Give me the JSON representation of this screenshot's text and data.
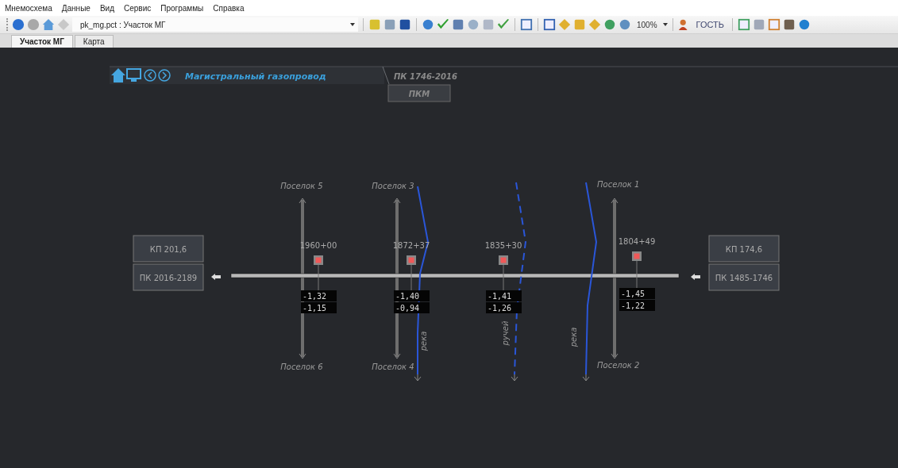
{
  "menu": [
    "Мнемосхема",
    "Данные",
    "Вид",
    "Сервис",
    "Программы",
    "Справка"
  ],
  "toolbar": {
    "file": "pk_mg.pct : Участок МГ",
    "zoom": "100%",
    "user": "ГОСТЬ"
  },
  "tabs": [
    {
      "label": "Участок МГ",
      "selected": true
    },
    {
      "label": "Карта",
      "selected": false
    }
  ],
  "scheme": {
    "breadcrumb": "Магистральный газопровод",
    "section": "ПК 1746-2016",
    "section_button": "ПКМ",
    "left_boxes": [
      "КП 201,6",
      "ПК 2016-2189"
    ],
    "right_boxes": [
      "КП 174,6",
      "ПК 1485-1746"
    ],
    "roads": [
      {
        "top": "Поселок 5",
        "bottom": "Поселок 6"
      },
      {
        "top": "Поселок 3",
        "bottom": "Поселок 4"
      },
      {
        "top": "Поселок 1",
        "bottom": "Поселок 2"
      }
    ],
    "waterways": [
      {
        "label": "река",
        "kind": "river"
      },
      {
        "label": "ручей",
        "kind": "stream"
      },
      {
        "label": "река",
        "kind": "river"
      }
    ],
    "points": [
      {
        "label": "1960+00",
        "values": [
          "-1,32",
          "-1,15"
        ]
      },
      {
        "label": "1872+37",
        "values": [
          "-1,40",
          "-0,94"
        ]
      },
      {
        "label": "1835+30",
        "values": [
          "-1,41",
          "-1,26"
        ]
      },
      {
        "label": "1804+49",
        "values": [
          "-1,45",
          "-1,22"
        ]
      }
    ]
  }
}
